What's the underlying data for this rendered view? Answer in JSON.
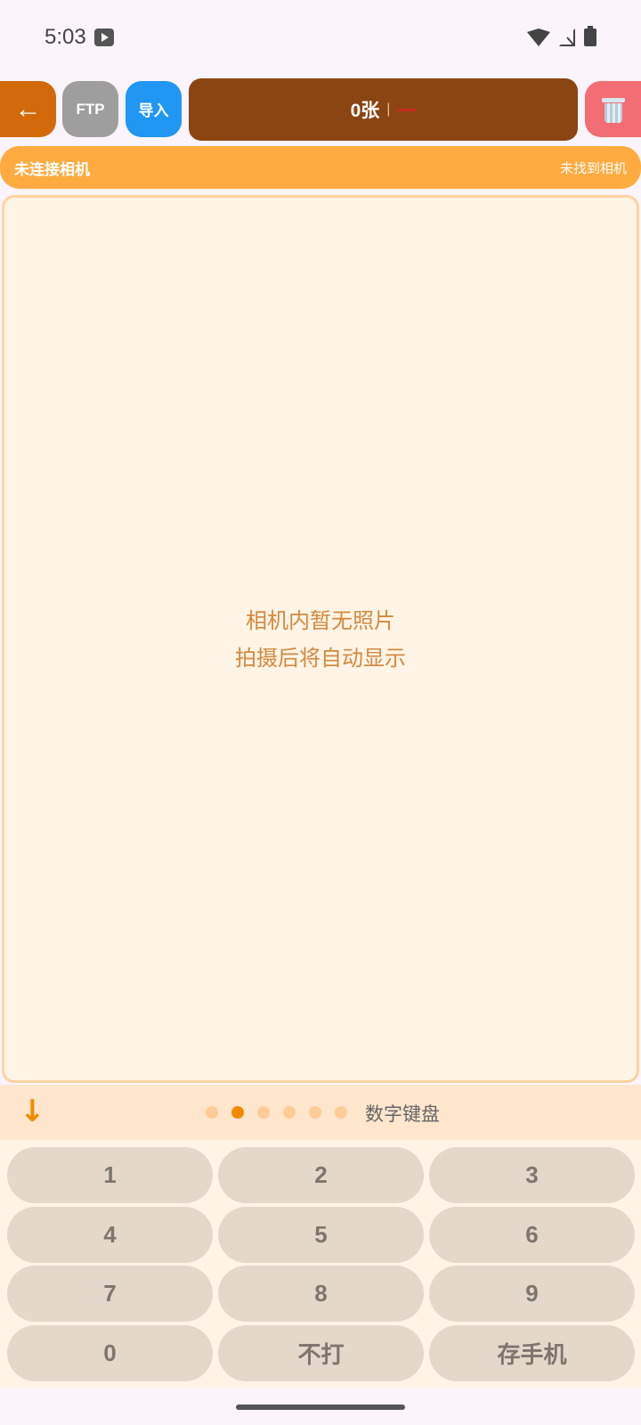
{
  "status_bar": {
    "time": "5:03"
  },
  "toolbar": {
    "back_label": "←",
    "ftp_label": "FTP",
    "import_label": "导入",
    "count_label": "0张",
    "count_separator": "|",
    "count_extra": "—"
  },
  "connection": {
    "left_text": "未连接相机",
    "right_text": "未找到相机"
  },
  "photo_panel": {
    "empty_line1": "相机内暂无照片",
    "empty_line2": "拍摄后将自动显示"
  },
  "page_bar": {
    "collapse_icon": "↓",
    "page_count": 6,
    "active_page": 1,
    "label": "数字键盘"
  },
  "keypad": {
    "keys": [
      "1",
      "2",
      "3",
      "4",
      "5",
      "6",
      "7",
      "8",
      "9",
      "0",
      "不打",
      "存手机"
    ]
  },
  "colors": {
    "back": "#d26a0c",
    "ftp": "#9e9e9e",
    "import": "#2196f3",
    "count": "#8b4513",
    "delete": "#f26d74",
    "connection_bar": "#ffab40",
    "accent": "#f18a00"
  }
}
